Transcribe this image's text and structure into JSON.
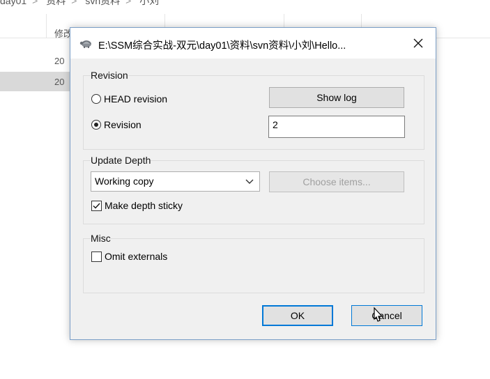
{
  "explorer": {
    "breadcrumb": [
      "day01",
      "资料",
      "svn资料",
      "小刘"
    ],
    "column_header": "修改日期",
    "rows": [
      "20",
      "20"
    ]
  },
  "dialog": {
    "title": "E:\\SSM综合实战-双元\\day01\\资料\\svn资料\\小刘\\Hello...",
    "close_glyph": "✕",
    "revision": {
      "group_label": "Revision",
      "head_label": "HEAD revision",
      "revision_label": "Revision",
      "selected": "revision",
      "show_log_label": "Show log",
      "revision_value": "2"
    },
    "depth": {
      "group_label": "Update Depth",
      "selected_option": "Working copy",
      "choose_items_label": "Choose items...",
      "sticky_label": "Make depth sticky",
      "sticky_checked": true
    },
    "misc": {
      "group_label": "Misc",
      "omit_externals_label": "Omit externals",
      "omit_externals_checked": false
    },
    "ok_label": "OK",
    "cancel_label": "Cancel"
  }
}
